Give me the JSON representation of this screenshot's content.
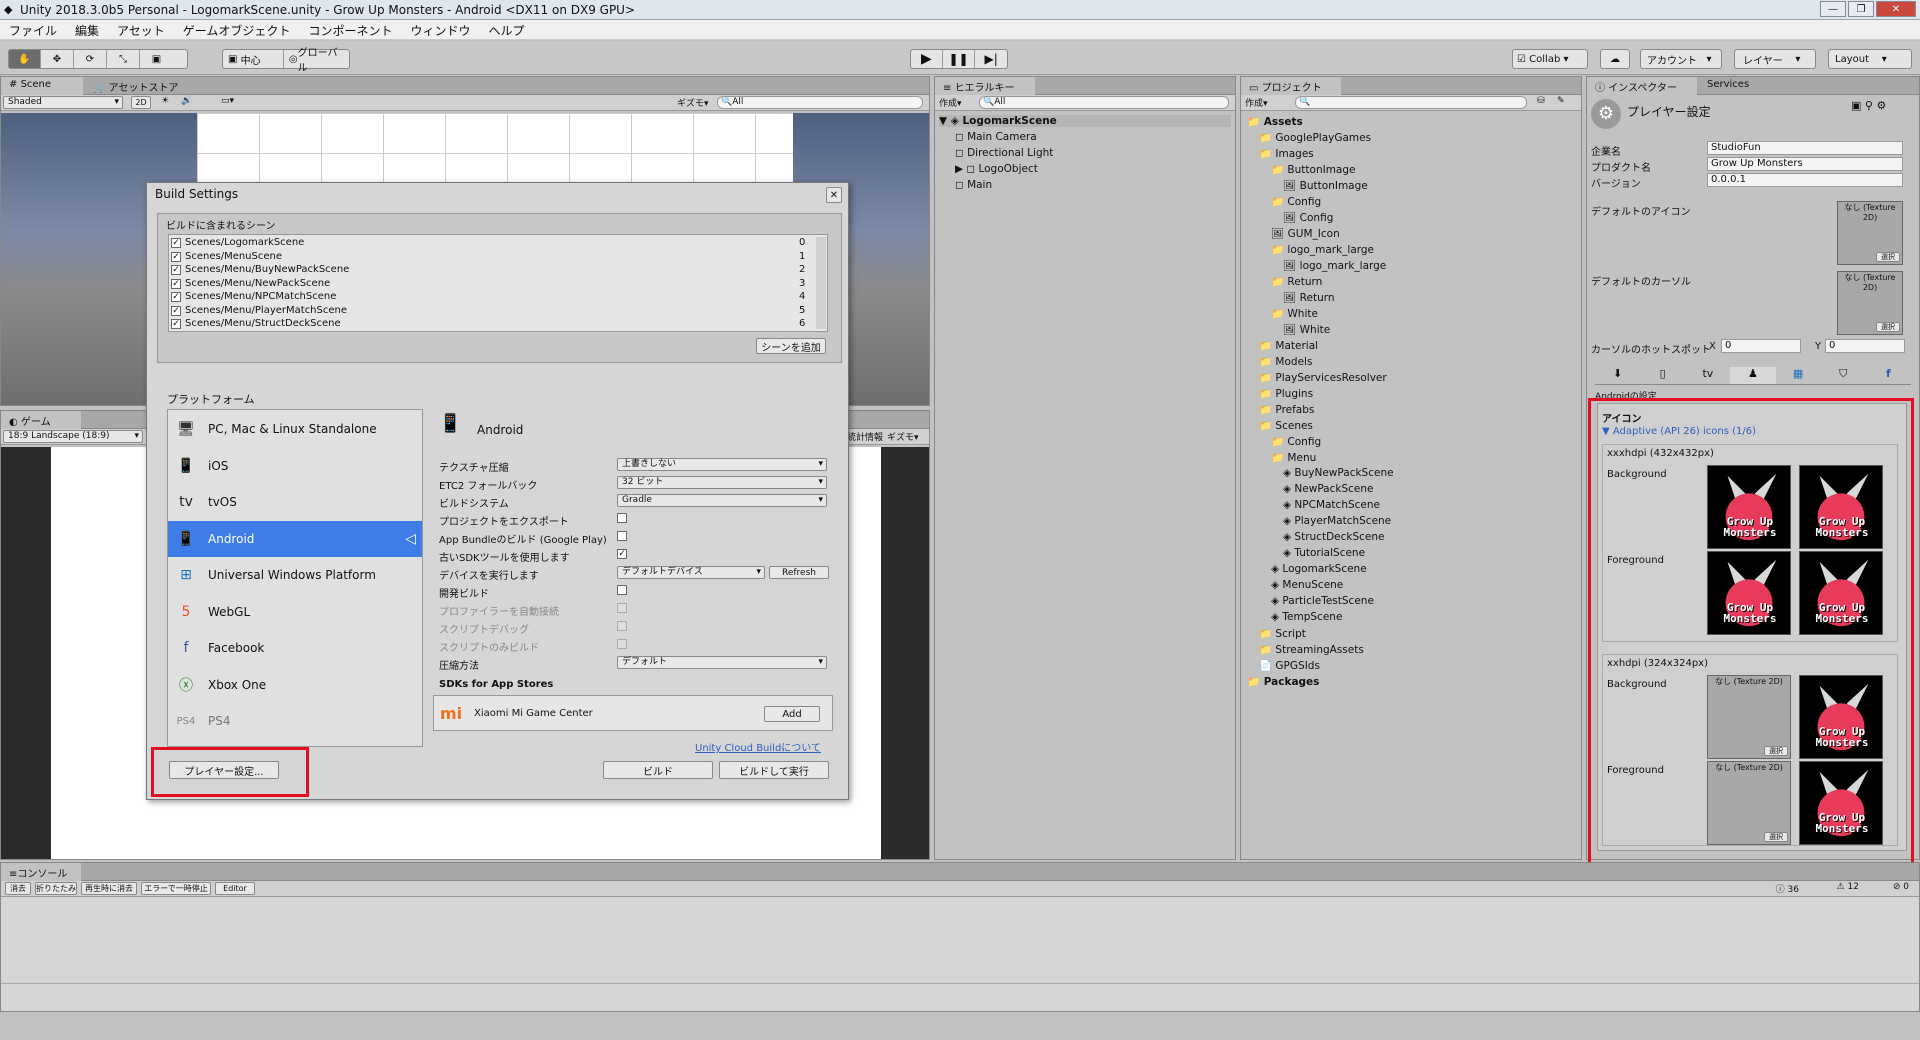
{
  "window": {
    "title": "Unity 2018.3.0b5 Personal - LogomarkScene.unity - Grow Up Monsters - Android <DX11 on DX9 GPU>"
  },
  "menu": [
    "ファイル",
    "編集",
    "アセット",
    "ゲームオブジェクト",
    "コンポーネント",
    "ウィンドウ",
    "ヘルプ"
  ],
  "toolbar": {
    "pivot": "中心",
    "space": "グローバル",
    "collab": "Collab",
    "account": "アカウント",
    "layers": "レイヤー",
    "layout": "Layout"
  },
  "scene": {
    "tab": "Scene",
    "tab2": "アセットストア",
    "shading": "Shaded",
    "mode2d": "2D",
    "gizmos": "ギズモ",
    "search": "All"
  },
  "game": {
    "tab": "ゲーム",
    "aspect": "18:9 Landscape (18:9)",
    "stats": "統計情報",
    "gizmos": "ギズモ"
  },
  "hierarchy": {
    "tab": "ヒエラルキー",
    "create": "作成",
    "search": "All",
    "scene": "LogomarkScene",
    "items": [
      "Main Camera",
      "Directional Light",
      "LogoObject",
      "Main"
    ]
  },
  "project": {
    "tab": "プロジェクト",
    "create": "作成",
    "items": [
      {
        "label": "Assets",
        "d": 0
      },
      {
        "label": "GooglePlayGames",
        "d": 1
      },
      {
        "label": "Images",
        "d": 1
      },
      {
        "label": "ButtonImage",
        "d": 2
      },
      {
        "label": "ButtonImage",
        "d": 3
      },
      {
        "label": "Config",
        "d": 2
      },
      {
        "label": "Config",
        "d": 3
      },
      {
        "label": "GUM_Icon",
        "d": 2
      },
      {
        "label": "logo_mark_large",
        "d": 2
      },
      {
        "label": "logo_mark_large",
        "d": 3
      },
      {
        "label": "Return",
        "d": 2
      },
      {
        "label": "Return",
        "d": 3
      },
      {
        "label": "White",
        "d": 2
      },
      {
        "label": "White",
        "d": 3
      },
      {
        "label": "Material",
        "d": 1
      },
      {
        "label": "Models",
        "d": 1
      },
      {
        "label": "PlayServicesResolver",
        "d": 1
      },
      {
        "label": "Plugins",
        "d": 1
      },
      {
        "label": "Prefabs",
        "d": 1
      },
      {
        "label": "Scenes",
        "d": 1
      },
      {
        "label": "Config",
        "d": 2
      },
      {
        "label": "Menu",
        "d": 2
      },
      {
        "label": "BuyNewPackScene",
        "d": 3
      },
      {
        "label": "NewPackScene",
        "d": 3
      },
      {
        "label": "NPCMatchScene",
        "d": 3
      },
      {
        "label": "PlayerMatchScene",
        "d": 3
      },
      {
        "label": "StructDeckScene",
        "d": 3
      },
      {
        "label": "TutorialScene",
        "d": 3
      },
      {
        "label": "LogomarkScene",
        "d": 2
      },
      {
        "label": "MenuScene",
        "d": 2
      },
      {
        "label": "ParticleTestScene",
        "d": 2
      },
      {
        "label": "TempScene",
        "d": 2
      },
      {
        "label": "Script",
        "d": 1
      },
      {
        "label": "StreamingAssets",
        "d": 1
      },
      {
        "label": "GPGSIds",
        "d": 1
      },
      {
        "label": "Packages",
        "d": 0
      }
    ]
  },
  "inspector": {
    "tab": "インスペクター",
    "tab2": "Services",
    "title": "プレイヤー設定",
    "company_label": "企業名",
    "company": "StudioFun",
    "product_label": "プロダクト名",
    "product": "Grow Up Monsters",
    "version_label": "バージョン",
    "version": "0.0.0.1",
    "default_icon": "デフォルトのアイコン",
    "default_cursor": "デフォルトのカーソル",
    "none_tex": "なし (Texture 2D)",
    "select": "選択",
    "hotspot": "カーソルのホットスポット",
    "x_label": "X",
    "x": "0",
    "y_label": "Y",
    "y": "0",
    "android_settings": "Androidの設定",
    "icon_header": "アイコン",
    "adaptive": "Adaptive (API 26) icons (1/6)",
    "xxxhdpi": "xxxhdpi (432x432px)",
    "xxhdpi": "xxhdpi (324x324px)",
    "background": "Background",
    "foreground": "Foreground",
    "monster_text": "Grow Up Monsters"
  },
  "build": {
    "title": "Build Settings",
    "scenes_header": "ビルドに含まれるシーン",
    "scenes": [
      {
        "name": "Scenes/LogomarkScene",
        "idx": "0"
      },
      {
        "name": "Scenes/MenuScene",
        "idx": "1"
      },
      {
        "name": "Scenes/Menu/BuyNewPackScene",
        "idx": "2"
      },
      {
        "name": "Scenes/Menu/NewPackScene",
        "idx": "3"
      },
      {
        "name": "Scenes/Menu/NPCMatchScene",
        "idx": "4"
      },
      {
        "name": "Scenes/Menu/PlayerMatchScene",
        "idx": "5"
      },
      {
        "name": "Scenes/Menu/StructDeckScene",
        "idx": "6"
      }
    ],
    "add_scene": "シーンを追加",
    "platform_header": "プラットフォーム",
    "platforms": [
      "PC, Mac & Linux Standalone",
      "iOS",
      "tvOS",
      "Android",
      "Universal Windows Platform",
      "WebGL",
      "Facebook",
      "Xbox One",
      "PS4"
    ],
    "selected": "Android",
    "settings": [
      {
        "label": "テクスチャ圧縮",
        "value": "上書きしない"
      },
      {
        "label": "ETC2 フォールバック",
        "value": "32 ビット"
      },
      {
        "label": "ビルドシステム",
        "value": "Gradle"
      },
      {
        "label": "プロジェクトをエクスポート",
        "value": ""
      },
      {
        "label": "App Bundleのビルド (Google Play)",
        "value": ""
      },
      {
        "label": "古いSDKツールを使用します",
        "value": ""
      },
      {
        "label": "デバイスを実行します",
        "value": "デフォルトデバイス"
      },
      {
        "label": "開発ビルド",
        "value": ""
      },
      {
        "label": "プロファイラーを自動接続",
        "value": ""
      },
      {
        "label": "スクリプトデバッグ",
        "value": ""
      },
      {
        "label": "スクリプトのみビルド",
        "value": ""
      },
      {
        "label": "圧縮方法",
        "value": "デフォルト"
      }
    ],
    "refresh": "Refresh",
    "sdks_header": "SDKs for App Stores",
    "xiaomi": "Xiaomi Mi Game Center",
    "add": "Add",
    "cloud_link": "Unity Cloud Buildについて",
    "player_settings": "プレイヤー設定...",
    "build": "ビルド",
    "build_run": "ビルドして実行"
  },
  "console": {
    "tab": "コンソール",
    "buttons": [
      "消去",
      "折りたたみ",
      "再生時に消去",
      "エラーで一時停止",
      "Editor"
    ],
    "counts": [
      "36",
      "12",
      "0"
    ]
  },
  "colors": {
    "selection": "#3e7ce8",
    "red": "#e01020",
    "link": "#3060c0"
  }
}
